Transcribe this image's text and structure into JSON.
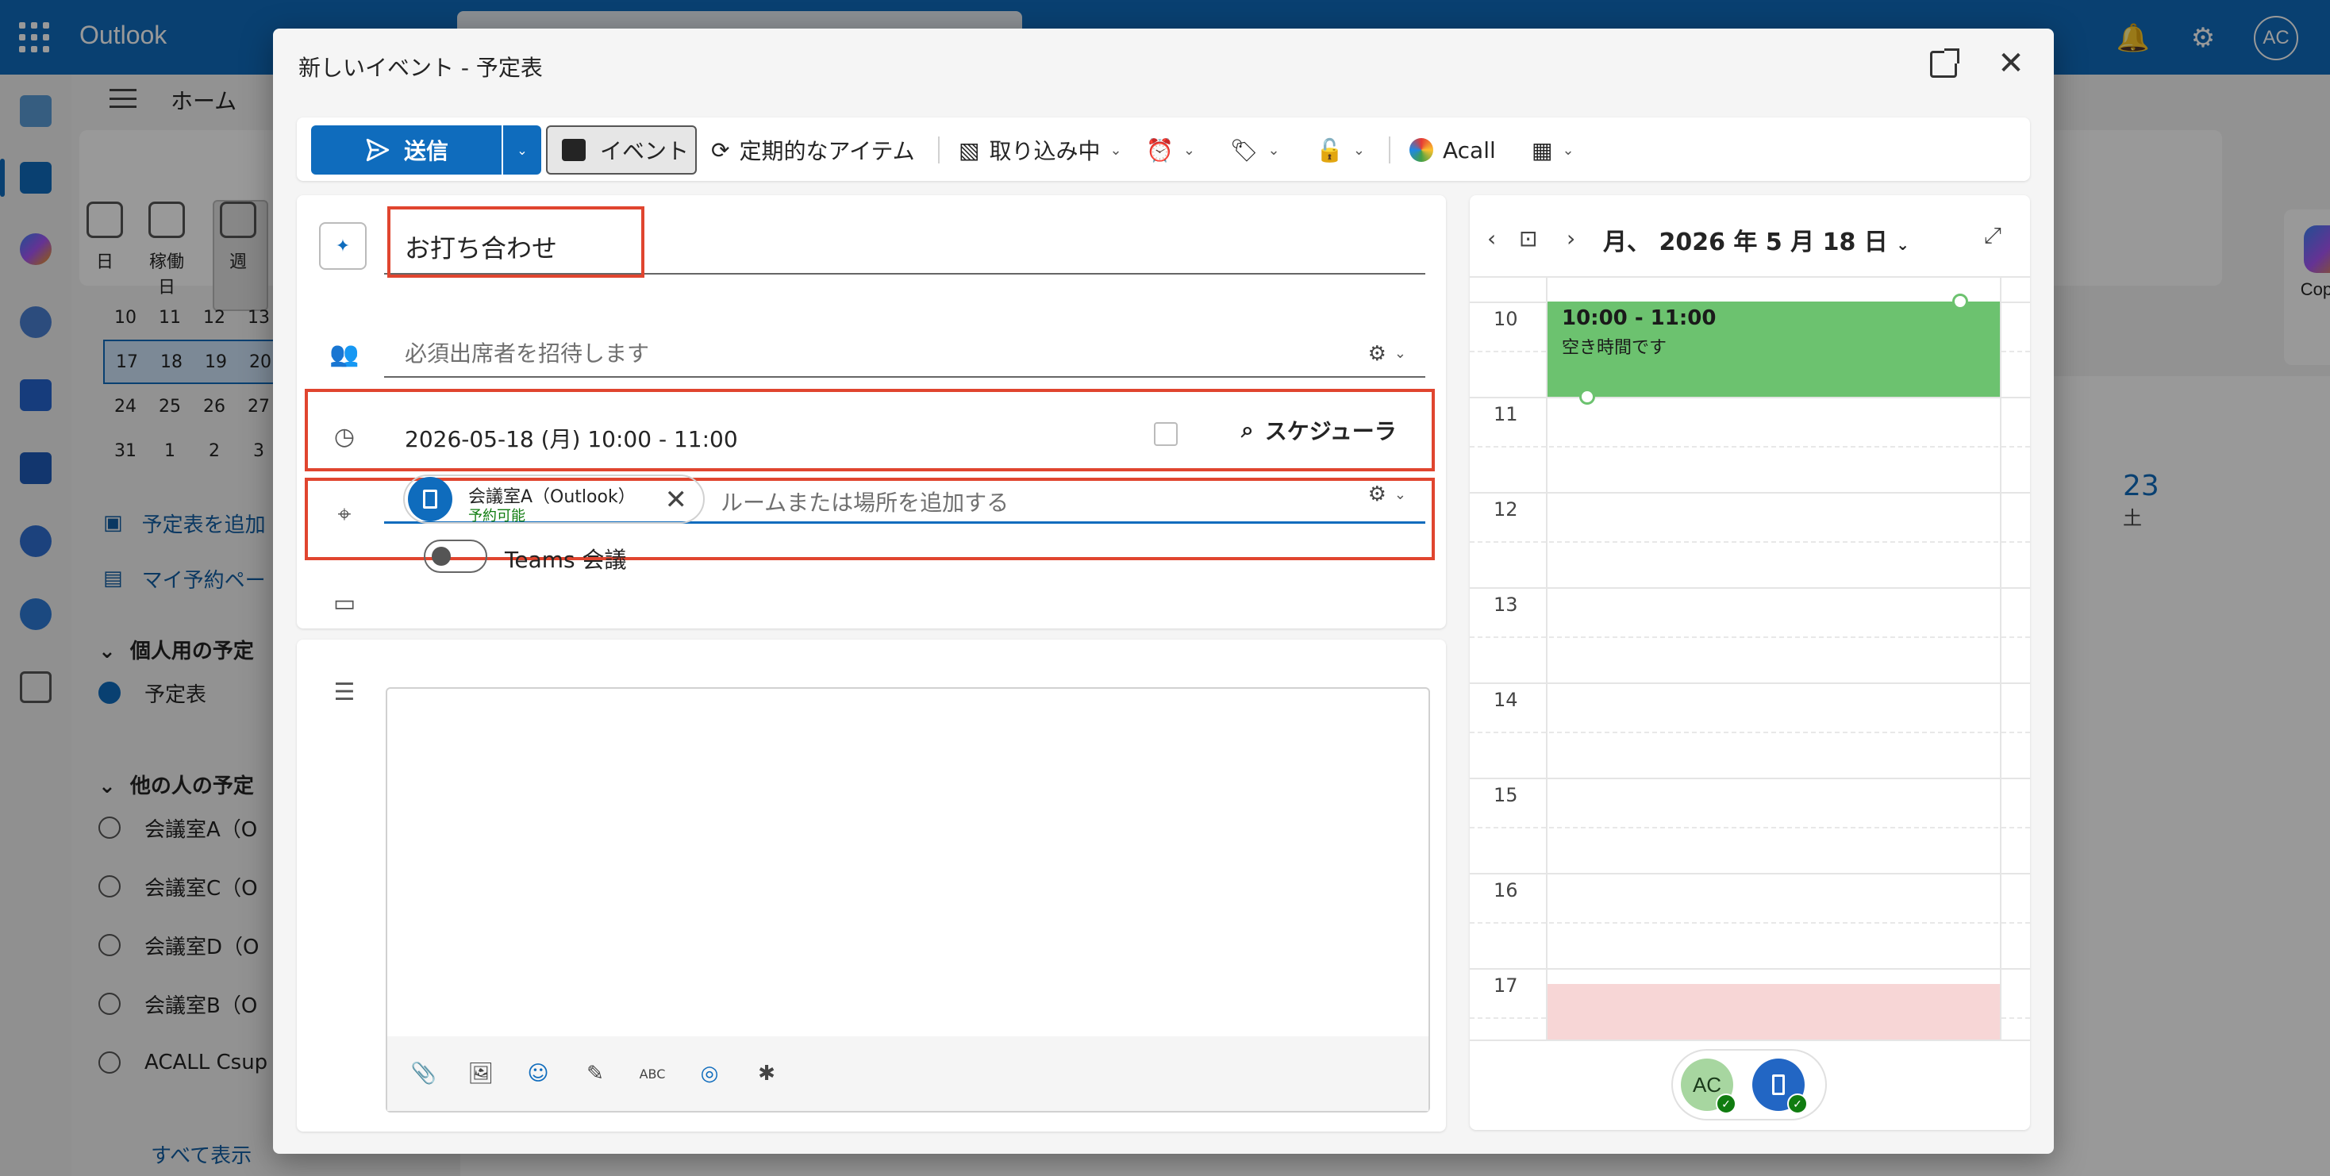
{
  "app": {
    "name": "Outlook",
    "user_initials": "AC"
  },
  "background": {
    "home_tab": "ホーム",
    "view_buttons": [
      "日",
      "稼働日",
      "週"
    ],
    "mini_calendar": [
      [
        "10",
        "11",
        "12",
        "13"
      ],
      [
        "17",
        "18",
        "19",
        "20"
      ],
      [
        "24",
        "25",
        "26",
        "27"
      ],
      [
        "31",
        "1",
        "2",
        "3"
      ]
    ],
    "links": [
      "予定表を追加",
      "マイ予約ペー"
    ],
    "personal_group": "個人用の予定",
    "personal_items": [
      "予定表"
    ],
    "others_group": "他の人の予定",
    "others_items": [
      "会議室A（O",
      "会議室C（O",
      "会議室D（O",
      "会議室B（O",
      "ACALL Csup"
    ],
    "show_all": "すべて表示",
    "day_number": "23",
    "day_label": "土",
    "copilot": "Copilot"
  },
  "modal": {
    "title": "新しいイベント - 予定表",
    "toolbar": {
      "send": "送信",
      "event": "イベント",
      "recurring": "定期的なアイテム",
      "busy_status": "取り込み中",
      "acall": "Acall"
    },
    "form": {
      "title_value": "お打ち合わせ",
      "attendees_placeholder": "必須出席者を招待します",
      "datetime": "2026-05-18 (月) 10:00 - 11:00",
      "scheduler": "スケジューラ",
      "room_name": "会議室A（Outlook）",
      "room_status": "予約可能",
      "location_placeholder": "ルームまたは場所を追加する",
      "teams_label": "Teams 会議"
    },
    "right_panel": {
      "date_header": "月、 2026 年 5 月 18 日",
      "hours": [
        "10",
        "11",
        "12",
        "13",
        "14",
        "15",
        "16",
        "17"
      ],
      "event_time": "10:00 - 11:00",
      "event_text": "空き時間です",
      "attendee_initials": "AC"
    }
  },
  "colors": {
    "brand": "#0f6cbd",
    "highlight": "#e0452f",
    "free_block": "#6cc26f",
    "busy_block": "#f7d6d6"
  }
}
